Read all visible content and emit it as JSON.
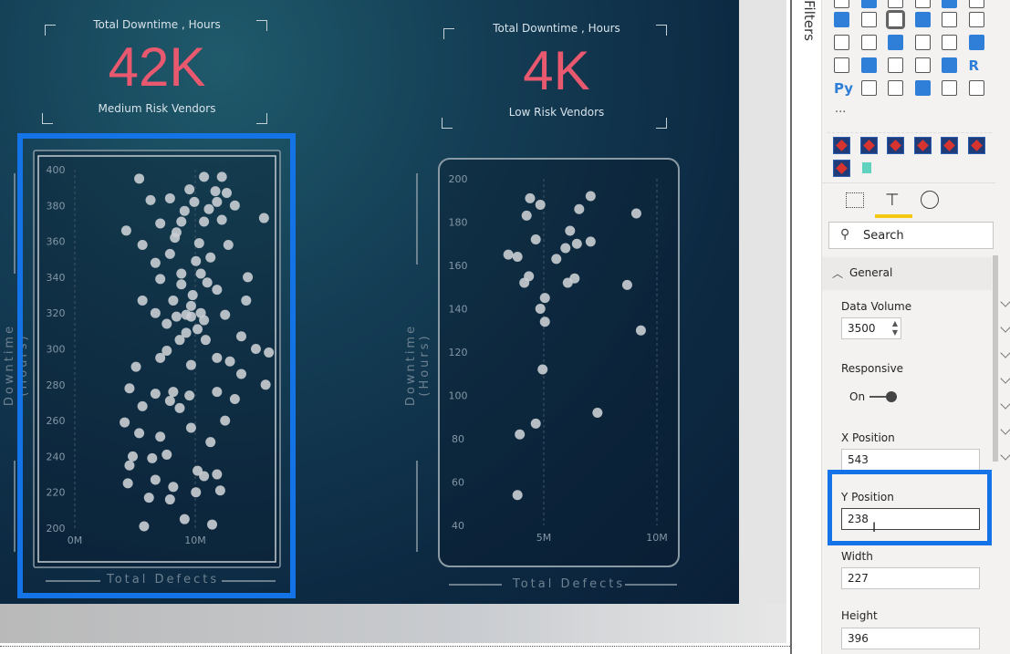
{
  "report": {
    "kpi_left": {
      "label": "Total Downtime , Hours",
      "value": "42K",
      "subtitle": "Medium Risk Vendors"
    },
    "kpi_right": {
      "label": "Total Downtime , Hours",
      "value": "4K",
      "subtitle": "Low Risk Vendors"
    },
    "colors": {
      "kpi_value": "#e8596f",
      "selection": "#1473e6",
      "points": "#c9ced3"
    }
  },
  "chart_data": [
    {
      "type": "scatter",
      "xlabel": "Total Defects",
      "ylabel": "Downtime (Hours)",
      "xticks": [
        "0M",
        "10M"
      ],
      "yticks": [
        "200",
        "220",
        "240",
        "260",
        "280",
        "300",
        "320",
        "340",
        "360",
        "380",
        "400"
      ],
      "xlim": [
        0,
        12.5
      ],
      "ylim": [
        200,
        400
      ],
      "grid": true,
      "points": [
        [
          4.2,
          395
        ],
        [
          8.2,
          396
        ],
        [
          9.3,
          396
        ],
        [
          7.3,
          389
        ],
        [
          9.6,
          387
        ],
        [
          4.9,
          383
        ],
        [
          6.1,
          384
        ],
        [
          7.6,
          382
        ],
        [
          9.0,
          382
        ],
        [
          10.1,
          380
        ],
        [
          11.9,
          373
        ],
        [
          5.5,
          370
        ],
        [
          6.8,
          371
        ],
        [
          8.2,
          371
        ],
        [
          9.3,
          372
        ],
        [
          3.4,
          366
        ],
        [
          6.5,
          365
        ],
        [
          9.7,
          358
        ],
        [
          7.9,
          359
        ],
        [
          4.4,
          358
        ],
        [
          6.1,
          353
        ],
        [
          8.6,
          351
        ],
        [
          7.7,
          349
        ],
        [
          5.2,
          348
        ],
        [
          10.9,
          340
        ],
        [
          8.0,
          342
        ],
        [
          5.5,
          339
        ],
        [
          6.8,
          336
        ],
        [
          9.0,
          333
        ],
        [
          4.4,
          327
        ],
        [
          6.3,
          327
        ],
        [
          7.4,
          324
        ],
        [
          10.8,
          327
        ],
        [
          5.2,
          320
        ],
        [
          7.1,
          319
        ],
        [
          8.2,
          316
        ],
        [
          9.5,
          319
        ],
        [
          5.9,
          314
        ],
        [
          7.8,
          311
        ],
        [
          10.5,
          307
        ],
        [
          6.7,
          305
        ],
        [
          11.4,
          300
        ],
        [
          12.2,
          298
        ],
        [
          5.9,
          299
        ],
        [
          5.5,
          295
        ],
        [
          9.0,
          295
        ],
        [
          9.8,
          293
        ],
        [
          7.4,
          291
        ],
        [
          4.0,
          290
        ],
        [
          10.5,
          286
        ],
        [
          12.0,
          280
        ],
        [
          3.6,
          278
        ],
        [
          6.3,
          276
        ],
        [
          9.0,
          276
        ],
        [
          5.2,
          275
        ],
        [
          10.1,
          272
        ],
        [
          7.3,
          274
        ],
        [
          6.1,
          271
        ],
        [
          4.4,
          268
        ],
        [
          6.7,
          267
        ],
        [
          3.3,
          259
        ],
        [
          9.5,
          260
        ],
        [
          7.4,
          256
        ],
        [
          4.2,
          253
        ],
        [
          5.5,
          251
        ],
        [
          8.6,
          248
        ],
        [
          3.8,
          240
        ],
        [
          5.0,
          239
        ],
        [
          5.9,
          241
        ],
        [
          3.6,
          235
        ],
        [
          7.8,
          232
        ],
        [
          9.0,
          230
        ],
        [
          8.2,
          229
        ],
        [
          5.2,
          227
        ],
        [
          6.3,
          223
        ],
        [
          7.7,
          220
        ],
        [
          4.8,
          217
        ],
        [
          9.2,
          221
        ],
        [
          6.1,
          216
        ],
        [
          7.0,
          205
        ],
        [
          8.7,
          202
        ],
        [
          4.5,
          201
        ],
        [
          3.5,
          225
        ],
        [
          6.8,
          342
        ],
        [
          8.4,
          337
        ],
        [
          7.4,
          318
        ],
        [
          8.0,
          320
        ],
        [
          8.3,
          305
        ],
        [
          7.1,
          309
        ],
        [
          6.5,
          318
        ],
        [
          8.9,
          388
        ],
        [
          8.5,
          378
        ],
        [
          7.0,
          377
        ],
        [
          6.4,
          362
        ],
        [
          7.5,
          330
        ]
      ]
    },
    {
      "type": "scatter",
      "xlabel": "Total Defects",
      "ylabel": "Downtime (Hours)",
      "xticks": [
        "5M",
        "10M"
      ],
      "yticks": [
        "40",
        "60",
        "80",
        "100",
        "120",
        "140",
        "160",
        "180",
        "200"
      ],
      "xlim": [
        0,
        10.5
      ],
      "ylim": [
        40,
        200
      ],
      "grid": true,
      "points": [
        [
          4.35,
          191
        ],
        [
          4.8,
          188
        ],
        [
          7.0,
          192
        ],
        [
          9.0,
          184
        ],
        [
          4.2,
          183
        ],
        [
          6.5,
          186
        ],
        [
          6.1,
          176
        ],
        [
          4.6,
          172
        ],
        [
          5.9,
          168
        ],
        [
          7.0,
          171
        ],
        [
          6.4,
          170
        ],
        [
          3.4,
          165
        ],
        [
          3.8,
          164
        ],
        [
          5.5,
          163
        ],
        [
          4.3,
          155
        ],
        [
          4.1,
          152
        ],
        [
          6.3,
          154
        ],
        [
          6.0,
          152
        ],
        [
          8.6,
          151
        ],
        [
          5.0,
          145
        ],
        [
          4.8,
          140
        ],
        [
          5.0,
          134
        ],
        [
          9.2,
          130
        ],
        [
          4.9,
          112
        ],
        [
          7.3,
          92
        ],
        [
          4.6,
          87
        ],
        [
          3.9,
          82
        ],
        [
          3.8,
          54
        ]
      ]
    }
  ],
  "filters_label": "Filters",
  "pane": {
    "more_label": "...",
    "search_placeholder": "Search",
    "section": "General",
    "data_volume": {
      "label": "Data Volume",
      "value": "3500"
    },
    "responsive": {
      "label": "Responsive",
      "value": "On",
      "on": true
    },
    "x_position": {
      "label": "X Position",
      "value": "543"
    },
    "y_position": {
      "label": "Y Position",
      "value": "238"
    },
    "width": {
      "label": "Width",
      "value": "227"
    },
    "height": {
      "label": "Height",
      "value": "396"
    },
    "r_label": "R",
    "py_label": "Py"
  }
}
